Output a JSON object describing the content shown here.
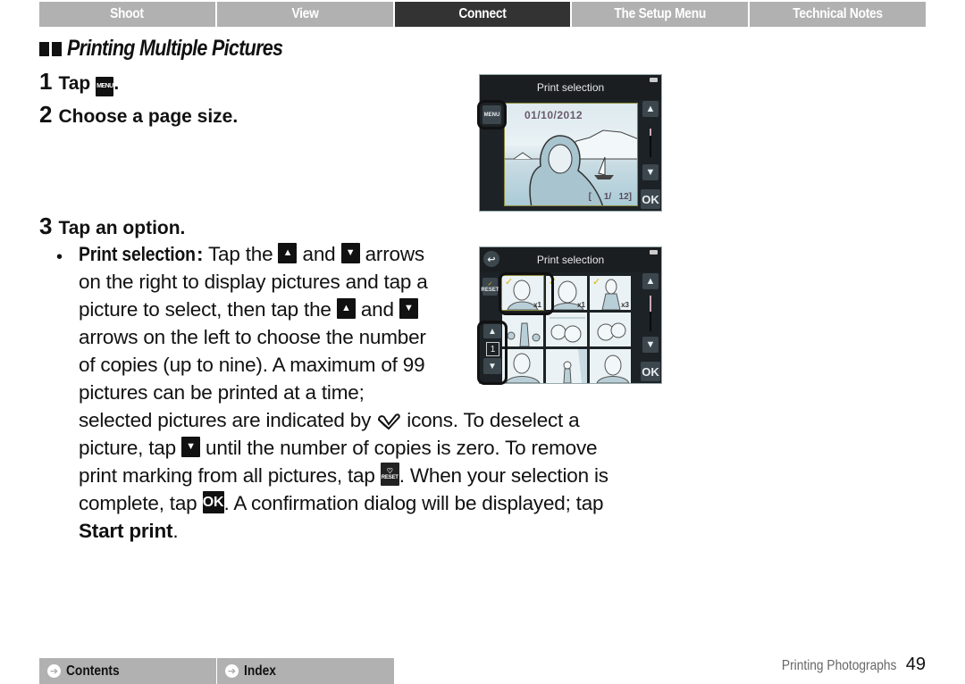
{
  "top_nav": {
    "tabs": [
      {
        "label": "Shoot",
        "active": false
      },
      {
        "label": "View",
        "active": false
      },
      {
        "label": "Connect",
        "active": true
      },
      {
        "label": "The Setup Menu",
        "active": false
      },
      {
        "label": "Technical Notes",
        "active": false
      }
    ]
  },
  "section": {
    "marker_icon": "double-bar-icon",
    "title": "Printing Multiple Pictures"
  },
  "steps": [
    {
      "num": "1",
      "text_before": "Tap",
      "icon": "menu-button-icon",
      "icon_label": "MENU",
      "text_after": "."
    },
    {
      "num": "2",
      "text": "Choose a page size."
    },
    {
      "num": "3",
      "text": "Tap an option."
    }
  ],
  "option": {
    "bullet": "•",
    "name": "Print selection",
    "colon": ":",
    "line1_a": " Tap the",
    "up_icon": "▲",
    "and": "and",
    "down_icon": "▼",
    "line1_b": "arrows",
    "line2": "on the right to display pictures and tap a",
    "line3_a": "picture to select, then tap the",
    "line4": "arrows on the left to choose the number",
    "line5": "of copies (up to nine). A maximum of 99",
    "line6": "pictures can be printed at a time;",
    "line7_a": "selected pictures are indicated by",
    "check_icon": "✓",
    "line7_b": "icons. To deselect a",
    "line8_a": "picture, tap",
    "line8_b": "until the number of copies is zero. To remove",
    "line9_a": "print marking from all pictures, tap",
    "reset_label": "RESET",
    "line9_b": ". When your selection is",
    "line10_a": "complete, tap",
    "ok_label": "OK",
    "line10_b": ". A confirmation dialog will be displayed; tap",
    "line11_bold": "Start print",
    "line11_end": "."
  },
  "screen1": {
    "header": "Print selection",
    "menu_button": "MENU",
    "date": "01/10/2012",
    "counter_left": "[",
    "counter": "1/",
    "counter_total": "12]",
    "up": "▲",
    "down": "▼",
    "ok": "OK"
  },
  "screen2": {
    "header": "Print selection",
    "back_icon": "↩",
    "reset_label": "RESET",
    "copies_value": "1",
    "up": "▲",
    "down": "▼",
    "ok": "OK",
    "thumbnails": [
      {
        "checked": true,
        "copies": "x1",
        "selected": true
      },
      {
        "checked": true,
        "copies": "x1",
        "selected": false
      },
      {
        "checked": true,
        "copies": "x3",
        "selected": false
      },
      {
        "checked": false,
        "copies": "",
        "selected": false
      },
      {
        "checked": false,
        "copies": "",
        "selected": false
      },
      {
        "checked": false,
        "copies": "",
        "selected": false
      },
      {
        "checked": false,
        "copies": "",
        "selected": false
      },
      {
        "checked": false,
        "copies": "",
        "selected": false
      },
      {
        "checked": false,
        "copies": "",
        "selected": false
      }
    ]
  },
  "footer": {
    "contents_label": "Contents",
    "index_label": "Index",
    "arrow_icon": "➔",
    "section_name": "Printing Photographs",
    "page_number": "49"
  }
}
